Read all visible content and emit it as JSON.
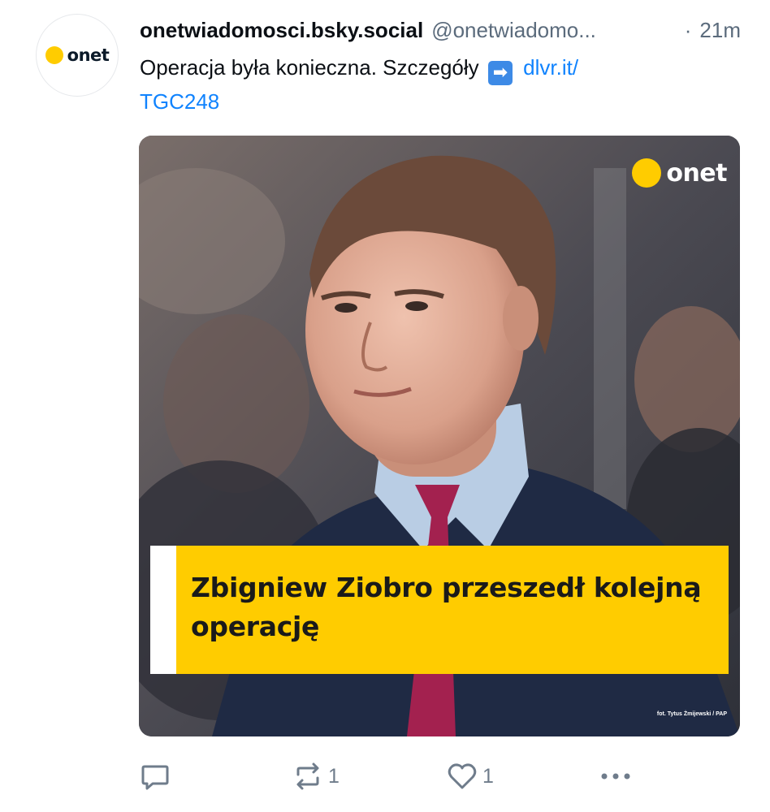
{
  "post": {
    "author": {
      "display_name": "onetwiadomosci.bsky.social",
      "handle": "@onetwiadomo...",
      "avatar_text": "onet",
      "avatar_icon": "onet-logo-icon"
    },
    "time_separator": "·",
    "time": "21m",
    "text": {
      "body": "Operacja była konieczna. Szczegóły",
      "emoji": "➡",
      "link_line1": "dlvr.it/",
      "link_line2": "TGC248"
    },
    "media": {
      "logo_text": "onet",
      "headline_line1": "Zbigniew Ziobro przeszedł kolejną",
      "headline_line2": "operację",
      "credit": "fot. Tytus Żmijewski / PAP"
    },
    "actions": {
      "reply_icon": "reply-icon",
      "repost_icon": "repost-icon",
      "repost_count": "1",
      "like_icon": "heart-icon",
      "like_count": "1",
      "more_icon": "more-icon",
      "more_label": "•••"
    }
  },
  "colors": {
    "brand_yellow": "#ffcc00",
    "link": "#1083fe",
    "muted": "#5b6b7c"
  }
}
